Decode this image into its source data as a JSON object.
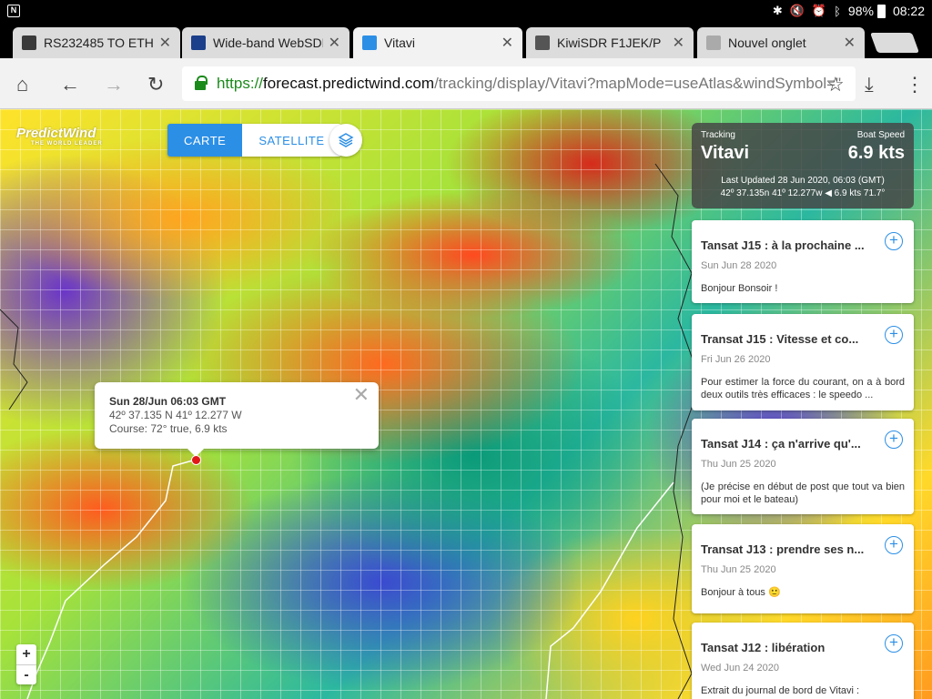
{
  "status": {
    "battery": "98%",
    "time": "08:22",
    "icons": [
      "bluetooth-icon",
      "mute-icon",
      "alarm-icon",
      "bluetooth-icon",
      "battery-icon"
    ]
  },
  "tabs": [
    {
      "title": "RS232485 TO ETH",
      "favicon_color": "#3a3a3a",
      "active": false
    },
    {
      "title": "Wide-band WebSDR",
      "favicon_color": "#1b3f8a",
      "active": false
    },
    {
      "title": "Vitavi",
      "favicon_color": "#2c8fe6",
      "active": true
    },
    {
      "title": "KiwiSDR F1JEK/P",
      "favicon_color": "#555555",
      "active": false
    },
    {
      "title": "Nouvel onglet",
      "favicon_color": "#aaaaaa",
      "active": false
    }
  ],
  "url": {
    "scheme": "https://",
    "host": "forecast.predictwind.com",
    "rest": "/tracking/display/Vitavi?mapMode=useAtlas&windSymbol=\""
  },
  "map": {
    "logo": "PredictWind",
    "logo_tagline": "THE WORLD LEADER",
    "carte": "CARTE",
    "satellite": "SATELLITE",
    "zoom_in": "+",
    "zoom_out": "-",
    "popup": {
      "datetime": "Sun 28/Jun 06:03 GMT",
      "position": "42º 37.135 N  41º 12.277 W",
      "course": "Course:  72° true,  6.9 kts",
      "close": "✕"
    }
  },
  "tracking": {
    "label": "Tracking",
    "boat_speed_label": "Boat Speed",
    "boat_name": "Vitavi",
    "speed": "6.9 kts",
    "updated": "Last Updated 28 Jun 2020, 06:03 (GMT)",
    "position": "42º 37.135n 41º 12.277w  ◀ 6.9 kts 71.7°"
  },
  "posts": [
    {
      "title": "Tansat J15 : à la prochaine ...",
      "date": "Sun Jun 28 2020",
      "body": "Bonjour Bonsoir !"
    },
    {
      "title": "Transat J15 : Vitesse et co...",
      "date": "Fri Jun 26 2020",
      "body": "Pour estimer la force du courant, on a à bord deux outils très efficaces : le speedo ..."
    },
    {
      "title": "Tansat J14 : ça n'arrive qu'...",
      "date": "Thu Jun 25 2020",
      "body": "(Je précise en début de post que tout va bien pour moi et le bateau)"
    },
    {
      "title": "Transat J13 : prendre ses n...",
      "date": "Thu Jun 25 2020",
      "body": "Bonjour à tous 🙂"
    },
    {
      "title": "Tansat J12 : libération",
      "date": "Wed Jun 24 2020",
      "body": "Extrait du journal de bord de Vitavi :"
    }
  ]
}
